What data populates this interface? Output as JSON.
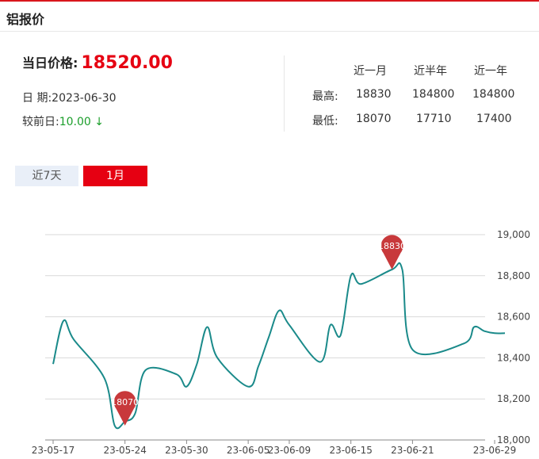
{
  "header": {
    "title": "铝报价"
  },
  "summary": {
    "price_label": "当日价格:",
    "price_value": "18520.00",
    "date_label": "日 期:",
    "date_value": "2023-06-30",
    "change_label": "较前日:",
    "change_value": "10.00 ↓"
  },
  "stats_table": {
    "columns": [
      "近一月",
      "近半年",
      "近一年"
    ],
    "rows": [
      {
        "label": "最高:",
        "values": [
          "18830",
          "184800",
          "184800"
        ]
      },
      {
        "label": "最低:",
        "values": [
          "18070",
          "17710",
          "17400"
        ]
      }
    ]
  },
  "tabs": [
    {
      "label": "近7天",
      "active": false
    },
    {
      "label": "1月",
      "active": true
    }
  ],
  "colors": {
    "accent": "#e60012",
    "line": "#1a8a8a",
    "marker": "#c8393b",
    "down": "#1a9e2a"
  },
  "chart_data": {
    "type": "line",
    "title": "",
    "xlabel": "",
    "ylabel": "",
    "ylim": [
      18000,
      19000
    ],
    "yticks": [
      "18,000",
      "18,200",
      "18,400",
      "18,600",
      "18,800",
      "19,000"
    ],
    "ytick_values": [
      18000,
      18200,
      18400,
      18600,
      18800,
      19000
    ],
    "xtick_labels": [
      "23-05-17",
      "23-05-24",
      "23-05-30",
      "23-06-05",
      "23-06-09",
      "23-06-15",
      "23-06-21",
      "23-06-29"
    ],
    "grid": true,
    "series": [
      {
        "x": [
          "23-05-17",
          "23-05-18",
          "23-05-19",
          "23-05-22",
          "23-05-23",
          "23-05-24",
          "23-05-25",
          "23-05-26",
          "23-05-29",
          "23-05-30",
          "23-05-31",
          "23-06-01",
          "23-06-02",
          "23-06-05",
          "23-06-06",
          "23-06-07",
          "23-06-08",
          "23-06-09",
          "23-06-12",
          "23-06-13",
          "23-06-14",
          "23-06-15",
          "23-06-16",
          "23-06-19",
          "23-06-20",
          "23-06-21",
          "23-06-26",
          "23-06-27",
          "23-06-28",
          "23-06-29",
          "23-06-30"
        ],
        "values": [
          18370,
          18580,
          18490,
          18300,
          18070,
          18090,
          18130,
          18340,
          18320,
          18260,
          18370,
          18550,
          18400,
          18260,
          18360,
          18500,
          18630,
          18560,
          18380,
          18560,
          18510,
          18800,
          18760,
          18830,
          18830,
          18440,
          18470,
          18550,
          18530,
          18520,
          18520
        ]
      }
    ],
    "markers": [
      {
        "label": "18070",
        "x": "23-05-24",
        "value": 18070
      },
      {
        "label": "18830",
        "x": "23-06-19",
        "value": 18830
      }
    ]
  }
}
